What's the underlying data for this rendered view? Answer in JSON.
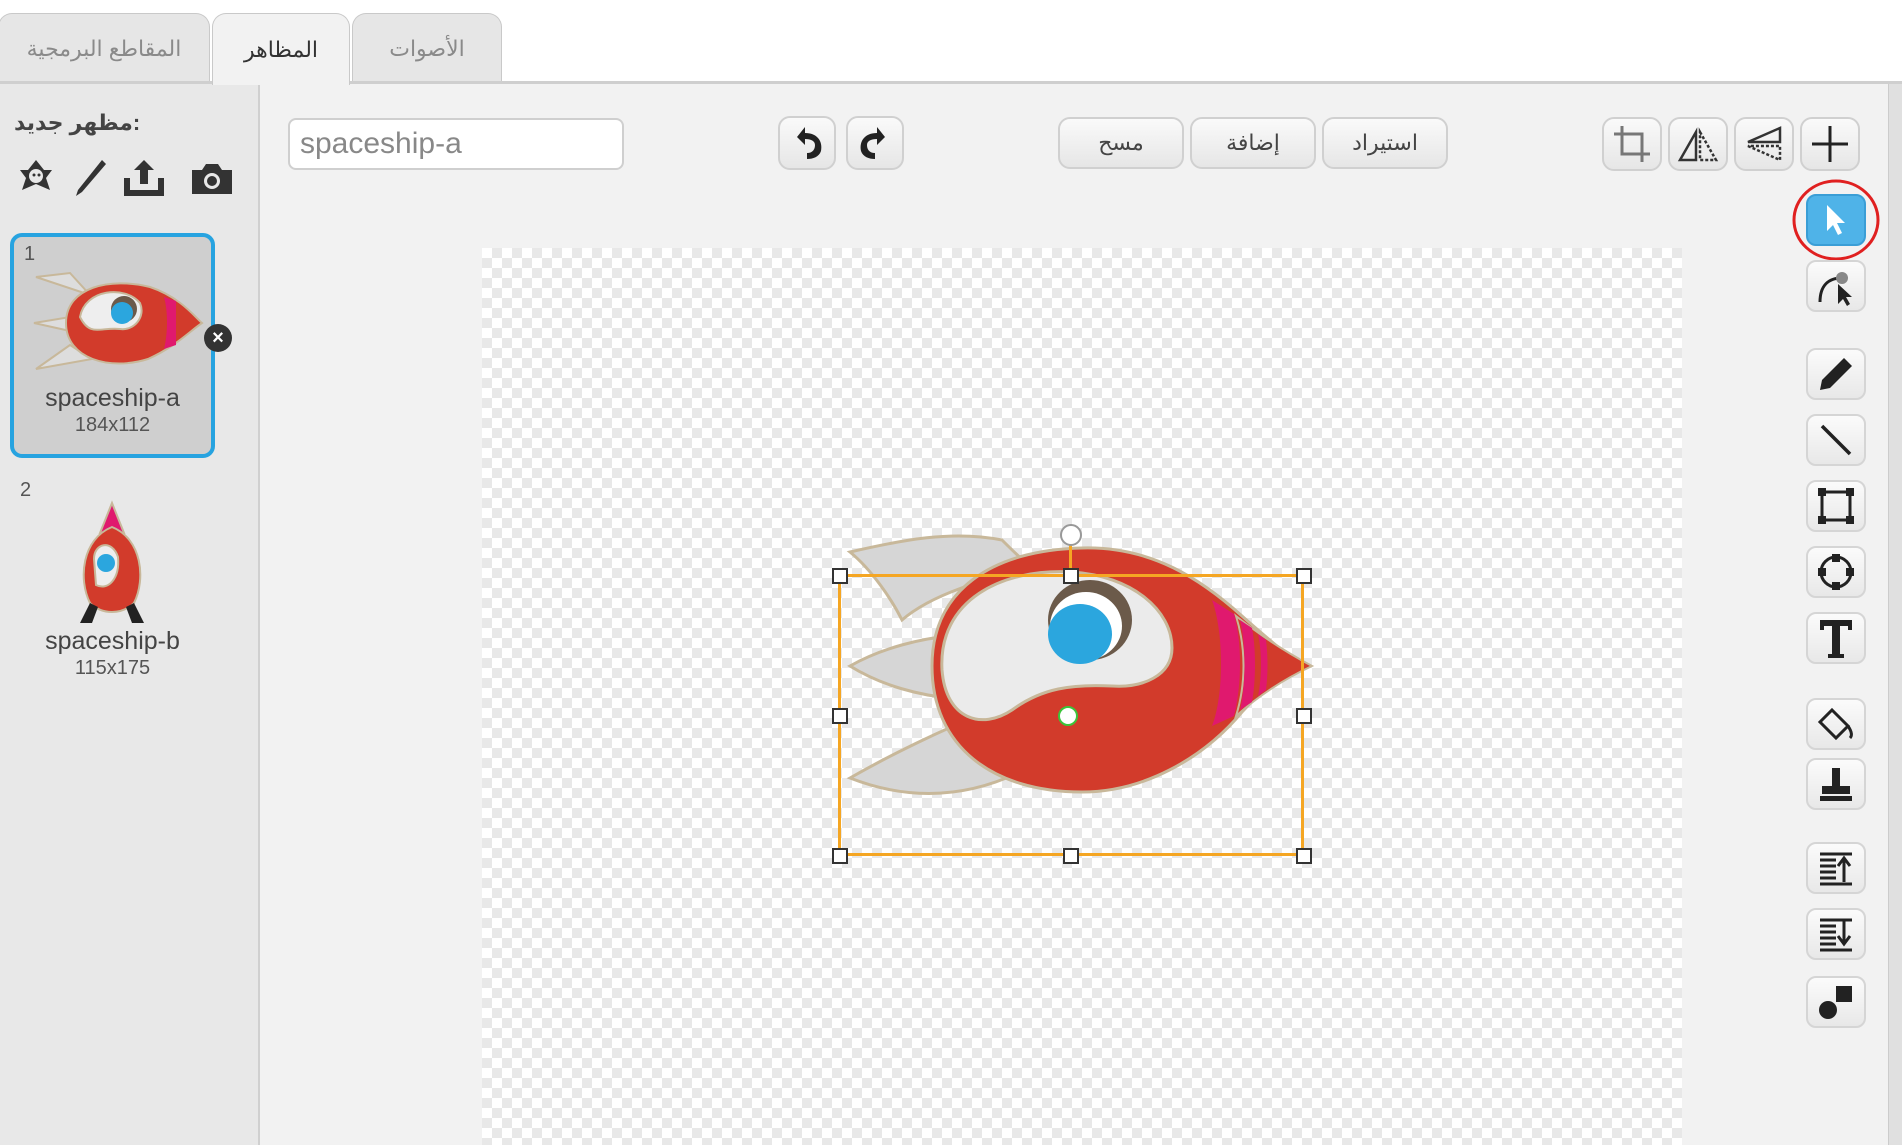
{
  "tabs": {
    "scripts": "المقاطع البرمجية",
    "costumes": "المظاهر",
    "sounds": "الأصوات"
  },
  "left": {
    "new_costume_label": "مظهر جديد:",
    "costumes": [
      {
        "number": "1",
        "name": "spaceship-a",
        "size": "184x112",
        "selected": true
      },
      {
        "number": "2",
        "name": "spaceship-b",
        "size": "115x175",
        "selected": false
      }
    ]
  },
  "editor": {
    "costume_name_value": "spaceship-a",
    "clear_label": "مسح",
    "add_label": "إضافة",
    "import_label": "استيراد"
  },
  "icons": {
    "new_from_library": "sprite-library-icon",
    "paint": "paintbrush-icon",
    "upload": "upload-icon",
    "camera": "camera-icon",
    "undo": "undo-icon",
    "redo": "redo-icon",
    "crop": "crop-icon",
    "flip_horizontal": "flip-horizontal-icon",
    "flip_vertical": "flip-vertical-icon",
    "center": "set-center-icon",
    "select": "select-arrow-icon",
    "reshape": "reshape-icon",
    "pencil": "pencil-icon",
    "line": "line-icon",
    "rectangle": "rectangle-icon",
    "ellipse": "ellipse-icon",
    "text": "text-icon",
    "fill": "paint-bucket-icon",
    "stamp": "stamp-icon",
    "forward": "bring-forward-icon",
    "backward": "send-backward-icon",
    "group": "group-icon"
  },
  "colors": {
    "selection": "#27a3e0",
    "active_tool": "#4fb3e8",
    "highlight_ring": "#e02020",
    "bounding_box": "#f5a623",
    "rocket_red": "#d23b2b",
    "rocket_window": "#2ba6de",
    "rocket_stripe": "#e0196e"
  }
}
